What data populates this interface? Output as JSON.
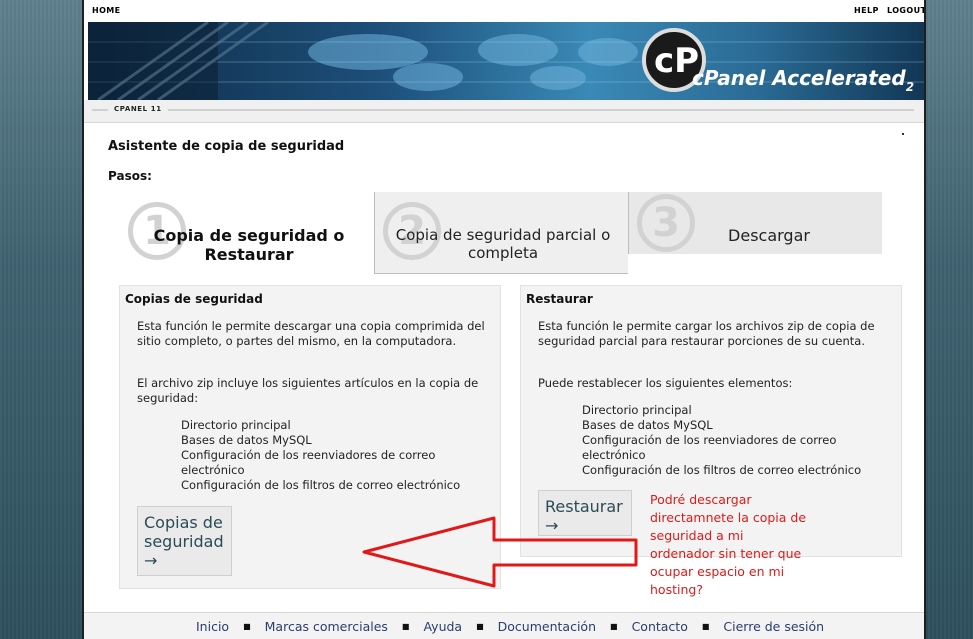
{
  "topnav": {
    "home": "HOME",
    "help": "HELP",
    "logout": "LOGOUT"
  },
  "banner": {
    "logo_text": "cPanel Accelerated",
    "logo_sub": "2"
  },
  "version_tag": "CPANEL 11",
  "page": {
    "title": "Asistente de copia de seguridad",
    "steps_label": "Pasos:"
  },
  "steps": [
    {
      "number": "1",
      "label": "Copia de seguridad o Restaurar",
      "active": true
    },
    {
      "number": "2",
      "label": "Copia de seguridad parcial o completa",
      "active": false
    },
    {
      "number": "3",
      "label": "Descargar",
      "active": false
    }
  ],
  "backup": {
    "heading": "Copias de seguridad",
    "desc": "Esta función le permite descargar una copia comprimida del sitio completo, o partes del mismo, en la computadora.",
    "list_intro": "El archivo zip incluye los siguientes artículos en la copia de seguridad:",
    "items": [
      "Directorio principal",
      "Bases de datos MySQL",
      "Configuración de los reenviadores de correo electrónico",
      "Configuración de los filtros de correo electrónico"
    ],
    "button_label": "Copias de seguridad",
    "button_arrow": "→"
  },
  "restore": {
    "heading": "Restaurar",
    "desc": "Esta función le permite cargar los archivos zip de copia de seguridad parcial para restaurar porciones de su cuenta.",
    "list_intro": "Puede restablecer los siguientes elementos:",
    "items": [
      "Directorio principal",
      "Bases de datos MySQL",
      "Configuración de los reenviadores de correo electrónico",
      "Configuración de los filtros de correo electrónico"
    ],
    "button_label": "Restaurar",
    "button_arrow": "→"
  },
  "annotation": {
    "text": "Podré descargar directamnete la copia de seguridad a mi ordenador sin tener que ocupar espacio en mi hosting?",
    "color": "#dd1a1a"
  },
  "footer": {
    "links": [
      "Inicio",
      "Marcas comerciales",
      "Ayuda",
      "Documentación",
      "Contacto",
      "Cierre de sesión"
    ]
  },
  "colors": {
    "link": "#2a3d6d",
    "button_text": "#2b4b57",
    "annotation": "#dd1a1a"
  }
}
